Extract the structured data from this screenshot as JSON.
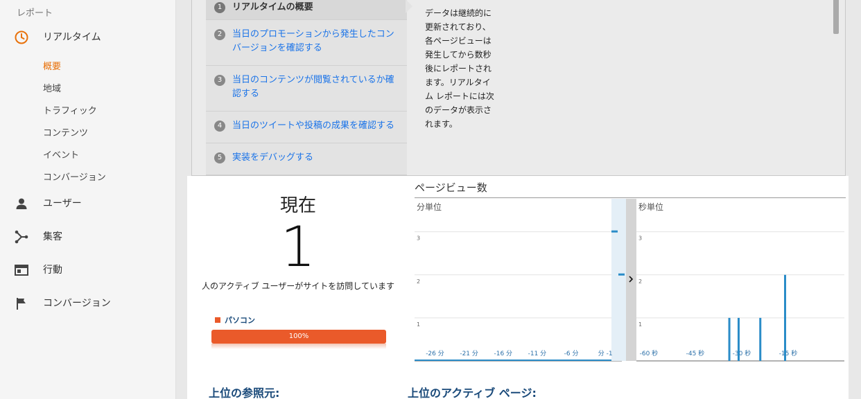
{
  "sidebar": {
    "section_label": "レポート",
    "realtime": {
      "label": "リアルタイム",
      "sub_items": [
        {
          "label": "概要",
          "active": true
        },
        {
          "label": "地域",
          "active": false
        },
        {
          "label": "トラフィック",
          "active": false
        },
        {
          "label": "コンテンツ",
          "active": false
        },
        {
          "label": "イベント",
          "active": false
        },
        {
          "label": "コンバージョン",
          "active": false
        }
      ]
    },
    "items": [
      {
        "label": "ユーザー",
        "icon": "person-icon"
      },
      {
        "label": "集客",
        "icon": "acquisition-icon"
      },
      {
        "label": "行動",
        "icon": "behavior-icon"
      },
      {
        "label": "コンバージョン",
        "icon": "flag-icon"
      }
    ]
  },
  "guide": {
    "steps": [
      {
        "num": "1",
        "text": "リアルタイムの概要"
      },
      {
        "num": "2",
        "text": "当日のプロモーションから発生したコンバージョンを確認する"
      },
      {
        "num": "3",
        "text": "当日のコンテンツが閲覧されているか確認する"
      },
      {
        "num": "4",
        "text": "当日のツイートや投稿の成果を確認する"
      },
      {
        "num": "5",
        "text": "実装をデバッグする"
      }
    ],
    "description": "データは継続的に更新されており、各ページビューは発生してから数秒後にレポートされます。リアルタイム レポートには次のデータが表示されます。"
  },
  "now": {
    "title": "現在",
    "count": "1",
    "caption": "人のアクティブ ユーザーがサイトを訪問しています",
    "device_label": "パソコン",
    "device_percent": "100%",
    "device_fraction": 1.0
  },
  "pageviews": {
    "title": "ページビュー数",
    "minute_label": "分単位",
    "second_label": "秒単位"
  },
  "chart_data": [
    {
      "type": "bar",
      "title": "分単位",
      "xlabel": "",
      "ylabel": "",
      "ylim": [
        0,
        3.3
      ],
      "yticks": [
        1,
        2,
        3
      ],
      "x_tick_labels": [
        "-26 分",
        "-21 分",
        "-16 分",
        "-11 分",
        "-6 分",
        "分 -1"
      ],
      "x_tick_positions": [
        -26,
        -21,
        -16,
        -11,
        -6,
        -1
      ],
      "x_range": [
        -29,
        0
      ],
      "series": [
        {
          "values": [
            {
              "x": -1,
              "y": 3
            },
            {
              "x": 0,
              "y": 2
            }
          ]
        }
      ]
    },
    {
      "type": "bar",
      "title": "秒単位",
      "xlabel": "",
      "ylabel": "",
      "ylim": [
        0,
        3.3
      ],
      "yticks": [
        1,
        2,
        3
      ],
      "x_tick_labels": [
        "-60 秒",
        "-45 秒",
        "-30 秒",
        "-15 秒"
      ],
      "x_tick_positions": [
        -60,
        -45,
        -30,
        -15
      ],
      "x_range": [
        -64,
        0
      ],
      "series": [
        {
          "values": [
            {
              "x": -34,
              "y": 1
            },
            {
              "x": -31,
              "y": 1
            },
            {
              "x": -24,
              "y": 1
            },
            {
              "x": -16,
              "y": 2
            }
          ]
        }
      ]
    }
  ],
  "bottom": {
    "referrers": "上位の参照元:",
    "active_pages": "上位のアクティブ ページ:"
  },
  "colors": {
    "accent_orange": "#e8710a",
    "bar_blue": "#2a8cc8",
    "device_orange": "#ea5a2a",
    "link_blue": "#1a73e8"
  }
}
